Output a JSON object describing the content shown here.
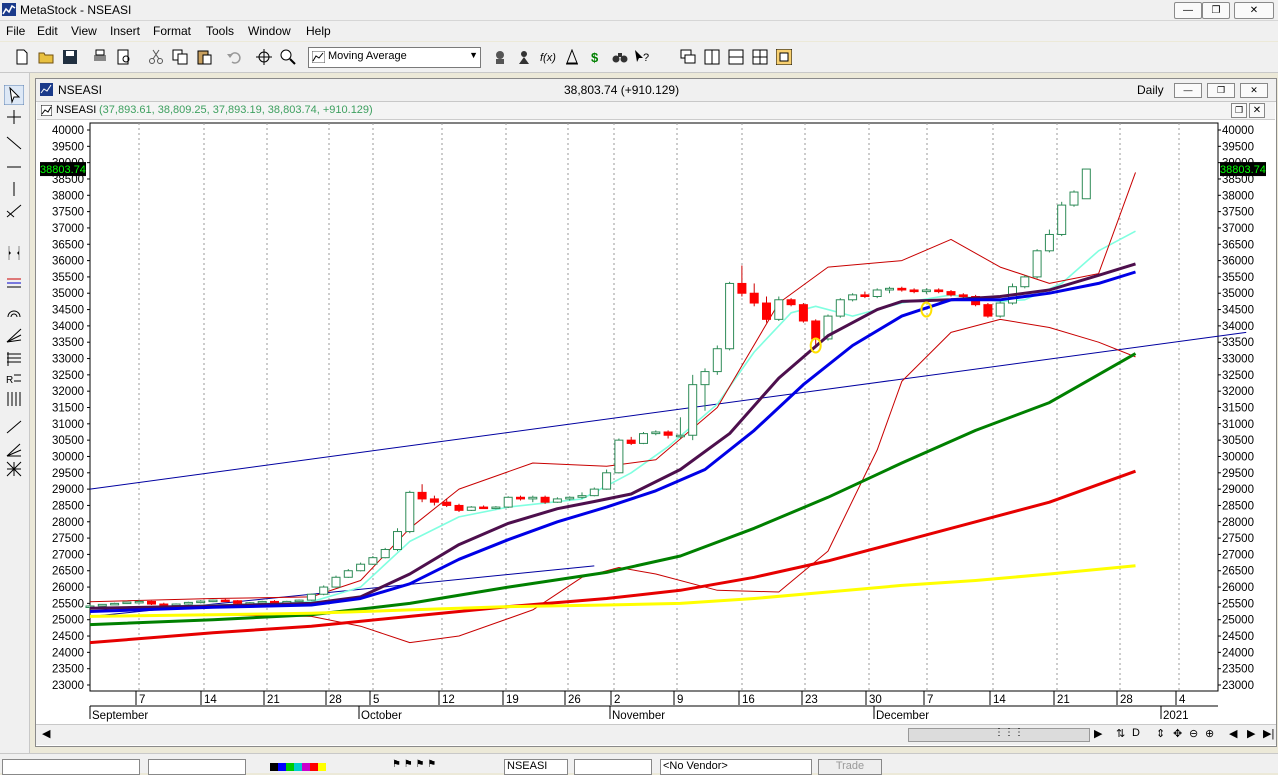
{
  "app": {
    "title": "MetaStock - NSEASI"
  },
  "menu": [
    "File",
    "Edit",
    "View",
    "Insert",
    "Format",
    "Tools",
    "Window",
    "Help"
  ],
  "toolbar": {
    "indicator_value": "Moving Average"
  },
  "chart_window": {
    "symbol": "NSEASI",
    "last_quote": "38,803.74 (+910.129)",
    "periodicity": "Daily",
    "inner_symbol": "NSEASI",
    "ohlc_text": "(37,893.61, 38,809.25, 37,893.19, 38,803.74, +910.129)"
  },
  "bottom": {
    "security": "NSEASI",
    "vendor": "<No Vendor>",
    "trade": "Trade"
  },
  "chart_data": {
    "type": "candlestick",
    "ylim": [
      23000,
      40000
    ],
    "y_ticks": [
      23000,
      23500,
      24000,
      24500,
      25000,
      25500,
      26000,
      26500,
      27000,
      27500,
      28000,
      28500,
      29000,
      29500,
      30000,
      30500,
      31000,
      31500,
      32000,
      32500,
      33000,
      33500,
      34000,
      34500,
      35000,
      35500,
      36000,
      36500,
      37000,
      37500,
      38000,
      38500,
      39000,
      39500,
      40000
    ],
    "last_price_label": "38803.74",
    "x_ticks": [
      "7",
      "14",
      "21",
      "28",
      "5",
      "12",
      "19",
      "26",
      "2",
      "9",
      "16",
      "23",
      "30",
      "7",
      "14",
      "21",
      "28",
      "4"
    ],
    "month_labels": [
      "September",
      "October",
      "November",
      "December",
      "2021"
    ],
    "candles": [
      [
        25400,
        25450,
        25380,
        25420
      ],
      [
        25420,
        25480,
        25400,
        25470
      ],
      [
        25470,
        25520,
        25450,
        25500
      ],
      [
        25500,
        25550,
        25480,
        25540
      ],
      [
        25540,
        25600,
        25500,
        25560
      ],
      [
        25560,
        25580,
        25450,
        25480
      ],
      [
        25480,
        25520,
        25420,
        25450
      ],
      [
        25450,
        25500,
        25400,
        25480
      ],
      [
        25480,
        25550,
        25460,
        25530
      ],
      [
        25530,
        25600,
        25500,
        25570
      ],
      [
        25570,
        25620,
        25540,
        25600
      ],
      [
        25600,
        25640,
        25550,
        25580
      ],
      [
        25580,
        25600,
        25480,
        25500
      ],
      [
        25500,
        25540,
        25450,
        25520
      ],
      [
        25520,
        25580,
        25500,
        25560
      ],
      [
        25560,
        25600,
        25520,
        25540
      ],
      [
        25540,
        25580,
        25500,
        25560
      ],
      [
        25560,
        25620,
        25540,
        25600
      ],
      [
        25600,
        25800,
        25580,
        25780
      ],
      [
        25780,
        26050,
        25750,
        26000
      ],
      [
        26000,
        26350,
        25980,
        26300
      ],
      [
        26300,
        26550,
        26280,
        26500
      ],
      [
        26500,
        26750,
        26480,
        26700
      ],
      [
        26700,
        26950,
        26680,
        26900
      ],
      [
        26900,
        27200,
        26880,
        27150
      ],
      [
        27150,
        27800,
        27100,
        27700
      ],
      [
        27700,
        28950,
        27650,
        28900
      ],
      [
        28900,
        29150,
        28600,
        28700
      ],
      [
        28700,
        28800,
        28500,
        28600
      ],
      [
        28600,
        28700,
        28450,
        28500
      ],
      [
        28500,
        28550,
        28300,
        28350
      ],
      [
        28350,
        28480,
        28330,
        28450
      ],
      [
        28450,
        28500,
        28400,
        28420
      ],
      [
        28420,
        28480,
        28380,
        28450
      ],
      [
        28450,
        28780,
        28420,
        28750
      ],
      [
        28750,
        28800,
        28650,
        28700
      ],
      [
        28700,
        28800,
        28600,
        28750
      ],
      [
        28750,
        28800,
        28550,
        28600
      ],
      [
        28600,
        28750,
        28580,
        28700
      ],
      [
        28700,
        28780,
        28650,
        28750
      ],
      [
        28750,
        28900,
        28700,
        28800
      ],
      [
        28800,
        29050,
        28780,
        29000
      ],
      [
        29000,
        29600,
        28980,
        29500
      ],
      [
        29500,
        30550,
        29480,
        30500
      ],
      [
        30500,
        30600,
        30350,
        30400
      ],
      [
        30400,
        30750,
        30380,
        30700
      ],
      [
        30700,
        30800,
        30650,
        30750
      ],
      [
        30750,
        30800,
        30550,
        30650
      ],
      [
        30650,
        31200,
        30550,
        30650
      ],
      [
        30650,
        32500,
        30500,
        32200
      ],
      [
        32200,
        32700,
        31400,
        32600
      ],
      [
        32600,
        33400,
        32500,
        33300
      ],
      [
        33300,
        35350,
        33250,
        35300
      ],
      [
        35300,
        35850,
        34900,
        35000
      ],
      [
        35000,
        35300,
        34600,
        34700
      ],
      [
        34700,
        34900,
        34100,
        34200
      ],
      [
        34200,
        34900,
        34150,
        34800
      ],
      [
        34800,
        34850,
        34600,
        34650
      ],
      [
        34650,
        34700,
        34100,
        34150
      ],
      [
        34150,
        34200,
        33400,
        33600
      ],
      [
        33600,
        34350,
        33550,
        34300
      ],
      [
        34300,
        34850,
        34250,
        34800
      ],
      [
        34800,
        35000,
        34750,
        34950
      ],
      [
        34950,
        35050,
        34850,
        34900
      ],
      [
        34900,
        35150,
        34850,
        35100
      ],
      [
        35100,
        35200,
        35000,
        35150
      ],
      [
        35150,
        35200,
        35050,
        35100
      ],
      [
        35100,
        35150,
        35000,
        35050
      ],
      [
        35050,
        35150,
        34980,
        35100
      ],
      [
        35100,
        35150,
        35000,
        35050
      ],
      [
        35050,
        35100,
        34900,
        34950
      ],
      [
        34950,
        35000,
        34850,
        34900
      ],
      [
        34900,
        34950,
        34600,
        34650
      ],
      [
        34650,
        34700,
        34250,
        34300
      ],
      [
        34300,
        34750,
        34250,
        34700
      ],
      [
        34700,
        35300,
        34650,
        35200
      ],
      [
        35200,
        35550,
        35150,
        35500
      ],
      [
        35500,
        36350,
        35450,
        36300
      ],
      [
        36300,
        36950,
        36250,
        36800
      ],
      [
        36800,
        37800,
        36750,
        37700
      ],
      [
        37700,
        38150,
        37650,
        38100
      ],
      [
        37893.61,
        38809.25,
        37893.19,
        38803.74
      ]
    ],
    "indicator_lines": [
      {
        "name": "",
        "color": "#80ffe0",
        "values": [
          [
            0,
            25350
          ],
          [
            10,
            25450
          ],
          [
            18,
            25550
          ],
          [
            22,
            26000
          ],
          [
            26,
            27400
          ],
          [
            30,
            28150
          ],
          [
            34,
            28450
          ],
          [
            40,
            28700
          ],
          [
            44,
            29500
          ],
          [
            47,
            30300
          ],
          [
            51,
            31600
          ],
          [
            54,
            33200
          ],
          [
            57,
            34400
          ],
          [
            59,
            34600
          ],
          [
            62,
            34300
          ],
          [
            66,
            34700
          ],
          [
            70,
            34950
          ],
          [
            74,
            34750
          ],
          [
            76,
            34800
          ],
          [
            79,
            35300
          ],
          [
            82,
            36300
          ],
          [
            85,
            36900
          ]
        ]
      },
      {
        "name": "",
        "color": "#4d0f4d",
        "values": [
          [
            0,
            25350
          ],
          [
            10,
            25420
          ],
          [
            18,
            25500
          ],
          [
            22,
            25700
          ],
          [
            26,
            26400
          ],
          [
            30,
            27300
          ],
          [
            34,
            27950
          ],
          [
            38,
            28400
          ],
          [
            41,
            28620
          ],
          [
            44,
            28850
          ],
          [
            48,
            29600
          ],
          [
            52,
            30700
          ],
          [
            56,
            32400
          ],
          [
            60,
            33700
          ],
          [
            64,
            34500
          ],
          [
            66,
            34750
          ],
          [
            70,
            34800
          ],
          [
            74,
            34900
          ],
          [
            78,
            35100
          ],
          [
            82,
            35550
          ],
          [
            85,
            35900
          ]
        ]
      },
      {
        "name": "",
        "color": "#0000e6",
        "values": [
          [
            0,
            25250
          ],
          [
            10,
            25380
          ],
          [
            18,
            25450
          ],
          [
            22,
            25650
          ],
          [
            26,
            26100
          ],
          [
            30,
            26850
          ],
          [
            34,
            27450
          ],
          [
            38,
            28000
          ],
          [
            42,
            28450
          ],
          [
            46,
            28950
          ],
          [
            50,
            29600
          ],
          [
            54,
            30800
          ],
          [
            58,
            32200
          ],
          [
            62,
            33400
          ],
          [
            66,
            34300
          ],
          [
            70,
            34800
          ],
          [
            74,
            34800
          ],
          [
            78,
            35000
          ],
          [
            82,
            35300
          ],
          [
            85,
            35650
          ]
        ]
      },
      {
        "name": "",
        "color": "#008000",
        "values": [
          [
            0,
            24850
          ],
          [
            10,
            25000
          ],
          [
            18,
            25150
          ],
          [
            26,
            25500
          ],
          [
            34,
            26000
          ],
          [
            42,
            26450
          ],
          [
            48,
            26950
          ],
          [
            54,
            27800
          ],
          [
            60,
            28750
          ],
          [
            66,
            29800
          ],
          [
            72,
            30800
          ],
          [
            78,
            31650
          ],
          [
            85,
            33150
          ]
        ]
      },
      {
        "name": "",
        "color": "#e60000",
        "values": [
          [
            0,
            24300
          ],
          [
            10,
            24600
          ],
          [
            18,
            24800
          ],
          [
            26,
            25100
          ],
          [
            34,
            25400
          ],
          [
            42,
            25650
          ],
          [
            48,
            25900
          ],
          [
            54,
            26300
          ],
          [
            60,
            26800
          ],
          [
            66,
            27400
          ],
          [
            72,
            28000
          ],
          [
            78,
            28600
          ],
          [
            85,
            29550
          ]
        ]
      },
      {
        "name": "",
        "color": "#ffff00",
        "values": [
          [
            0,
            25100
          ],
          [
            10,
            25150
          ],
          [
            18,
            25200
          ],
          [
            26,
            25300
          ],
          [
            34,
            25400
          ],
          [
            42,
            25450
          ],
          [
            48,
            25500
          ],
          [
            54,
            25650
          ],
          [
            60,
            25850
          ],
          [
            66,
            26050
          ],
          [
            72,
            26200
          ],
          [
            78,
            26400
          ],
          [
            85,
            26650
          ]
        ]
      },
      {
        "name": "",
        "color": "#c80000",
        "values": [
          [
            0,
            25550
          ],
          [
            10,
            25650
          ],
          [
            18,
            25700
          ],
          [
            22,
            26200
          ],
          [
            26,
            27800
          ],
          [
            30,
            29000
          ],
          [
            36,
            29800
          ],
          [
            42,
            29700
          ],
          [
            46,
            29900
          ],
          [
            51,
            31500
          ],
          [
            56,
            34700
          ],
          [
            60,
            35800
          ],
          [
            66,
            36000
          ],
          [
            70,
            36650
          ],
          [
            74,
            35800
          ],
          [
            78,
            35300
          ],
          [
            82,
            35600
          ],
          [
            85,
            38700
          ]
        ]
      },
      {
        "name": "",
        "color": "#c80000",
        "values": [
          [
            0,
            25100
          ],
          [
            10,
            25150
          ],
          [
            18,
            25100
          ],
          [
            22,
            24800
          ],
          [
            26,
            24300
          ],
          [
            30,
            24500
          ],
          [
            36,
            25300
          ],
          [
            40,
            26300
          ],
          [
            43,
            26600
          ],
          [
            46,
            26400
          ],
          [
            51,
            25900
          ],
          [
            56,
            25850
          ],
          [
            60,
            27100
          ],
          [
            64,
            30200
          ],
          [
            66,
            32300
          ],
          [
            70,
            33800
          ],
          [
            74,
            34200
          ],
          [
            78,
            33950
          ],
          [
            82,
            33500
          ],
          [
            85,
            33050
          ]
        ]
      }
    ],
    "trendlines": [
      {
        "name": "",
        "color": "#0000a0",
        "from": [
          0,
          29000
        ],
        "to": [
          94,
          33800
        ]
      },
      {
        "name": "",
        "color": "#0000a0",
        "from": [
          0,
          25100
        ],
        "to": [
          41,
          26650
        ]
      }
    ],
    "markers": [
      {
        "at": [
          59,
          33400
        ]
      },
      {
        "at": [
          68,
          34500
        ]
      }
    ]
  }
}
